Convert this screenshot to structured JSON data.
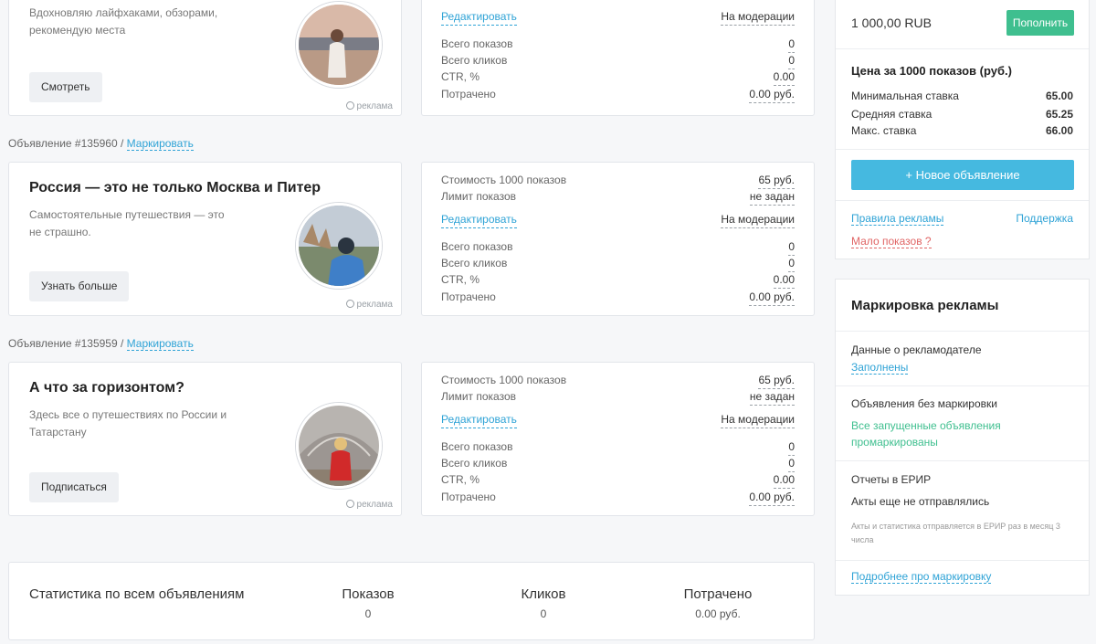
{
  "ads": [
    {
      "desc": "Вдохновляю лайфхаками, обзорами, рекомендую места",
      "button": "Смотреть",
      "promo": "реклама",
      "stats": {
        "edit": "Редактировать",
        "status": "На модерации",
        "impressions_label": "Всего показов",
        "impressions": "0",
        "clicks_label": "Всего кликов",
        "clicks": "0",
        "ctr_label": "CTR, %",
        "ctr": "0.00",
        "spent_label": "Потрачено",
        "spent": "0.00 руб."
      }
    },
    {
      "label": "Объявление #135960 /",
      "mark_link": "Маркировать",
      "title": "Россия — это не только Москва и Питер",
      "desc": "Самостоятельные путешествия — это не страшно.",
      "button": "Узнать больше",
      "promo": "реклама",
      "stats": {
        "cost_label": "Стоимость 1000 показов",
        "cost": "65 руб.",
        "limit_label": "Лимит показов",
        "limit": "не задан",
        "edit": "Редактировать",
        "status": "На модерации",
        "impressions_label": "Всего показов",
        "impressions": "0",
        "clicks_label": "Всего кликов",
        "clicks": "0",
        "ctr_label": "CTR, %",
        "ctr": "0.00",
        "spent_label": "Потрачено",
        "spent": "0.00 руб."
      }
    },
    {
      "label": "Объявление #135959 /",
      "mark_link": "Маркировать",
      "title": "А что за горизонтом?",
      "desc": "Здесь все о путешествиях по России и Татарстану",
      "button": "Подписаться",
      "promo": "реклама",
      "stats": {
        "cost_label": "Стоимость 1000 показов",
        "cost": "65 руб.",
        "limit_label": "Лимит показов",
        "limit": "не задан",
        "edit": "Редактировать",
        "status": "На модерации",
        "impressions_label": "Всего показов",
        "impressions": "0",
        "clicks_label": "Всего кликов",
        "clicks": "0",
        "ctr_label": "CTR, %",
        "ctr": "0.00",
        "spent_label": "Потрачено",
        "spent": "0.00 руб."
      }
    }
  ],
  "summary": {
    "title": "Статистика по всем объявлениям",
    "impressions_label": "Показов",
    "impressions": "0",
    "clicks_label": "Кликов",
    "clicks": "0",
    "spent_label": "Потрачено",
    "spent": "0.00 руб."
  },
  "balance": {
    "amount": "1 000,00 RUB",
    "topup": "Пополнить",
    "price_title": "Цена за 1000 показов (руб.)",
    "min_label": "Минимальная ставка",
    "min": "65.00",
    "avg_label": "Средняя ставка",
    "avg": "65.25",
    "max_label": "Макс. ставка",
    "max": "66.00",
    "new_ad": "+ Новое объявление",
    "rules": "Правила рекламы",
    "support": "Поддержка",
    "few_impressions": "Мало показов ?"
  },
  "marking": {
    "title": "Маркировка рекламы",
    "advertiser_label": "Данные о рекламодателе",
    "advertiser_value": "Заполнены",
    "unmarked_label": "Объявления без маркировки",
    "unmarked_value": "Все запущенные объявления промаркированы",
    "erir_label": "Отчеты в ЕРИР",
    "erir_value": "Акты еще не отправлялись",
    "erir_note": "Акты и статистика отправляется в ЕРИР раз в месяц 3 числа",
    "more_link": "Подробнее про маркировку"
  },
  "colors": {
    "accent_blue": "#2fa3d6",
    "green": "#3fbf8f",
    "new_ad_button": "#45b9e0"
  }
}
